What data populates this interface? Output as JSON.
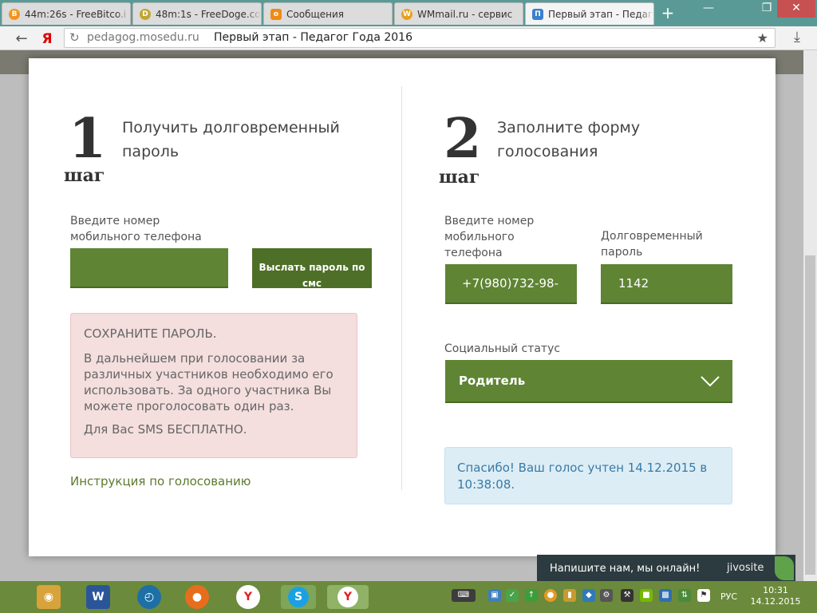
{
  "browser": {
    "tabs": [
      {
        "title": "44m:26s - FreeBitco.i",
        "icon": "bitcoin-icon",
        "color": "#f7931a",
        "glyph": "B"
      },
      {
        "title": "48m:1s - FreeDoge.co",
        "icon": "doge-icon",
        "color": "#c2a633",
        "glyph": "D"
      },
      {
        "title": "Сообщения",
        "icon": "odnoklassniki-icon",
        "color": "#f08a12",
        "glyph": "ок"
      },
      {
        "title": "WMmail.ru - сервис",
        "icon": "wmmail-icon",
        "color": "#e8a020",
        "glyph": "W"
      },
      {
        "title": "Первый этап - Педаг",
        "icon": "mosedu-icon",
        "color": "#3b7fcf",
        "glyph": "П"
      }
    ],
    "new_tab": "+",
    "url_site": "pedagog.mosedu.ru",
    "url_title": "Первый этап - Педагог Года 2016",
    "nav_glyph": "Я"
  },
  "step1": {
    "number": "1",
    "word": "шаг",
    "title_line1": "Получить долговременный",
    "title_line2": "пароль",
    "phone_label_line1": "Введите номер",
    "phone_label_line2": "мобильного телефона",
    "phone_value": "",
    "send_button_line1": "Выслать пароль по",
    "send_button_line2": "смс",
    "alert_title": "СОХРАНИТЕ ПАРОЛЬ.",
    "alert_body": "В дальнейшем при голосовании за различных участников необходимо его использовать. За одного участника Вы можете проголосовать один раз.",
    "alert_free": "Для Вас SMS БЕСПЛАТНО.",
    "instruction_link": "Инструкция по голосованию"
  },
  "step2": {
    "number": "2",
    "word": "шаг",
    "title_line1": "Заполните форму",
    "title_line2": "голосования",
    "phone_label_line1": "Введите номер",
    "phone_label_line2": "мобильного",
    "phone_label_line3": "телефона",
    "phone_value": "+7(980)732-98-",
    "password_label_line1": "Долговременный",
    "password_label_line2": "пароль",
    "password_value": "1142",
    "status_label": "Социальный статус",
    "status_value": "Родитель",
    "success_message": "Спасибо! Ваш голос учтен 14.12.2015 в 10:38:08."
  },
  "jivo": {
    "text": "Напишите нам, мы онлайн!",
    "brand": "jivosite"
  },
  "taskbar": {
    "lang": "РУС",
    "time": "10:31",
    "date": "14.12.2015"
  },
  "colors": {
    "green_field": "#5f8434",
    "green_button": "#4e6f27",
    "alert_red_bg": "#f4dede",
    "alert_blue_bg": "#dcedf6",
    "link_green": "#5b7a2d",
    "taskbar": "#6b8a3c"
  }
}
